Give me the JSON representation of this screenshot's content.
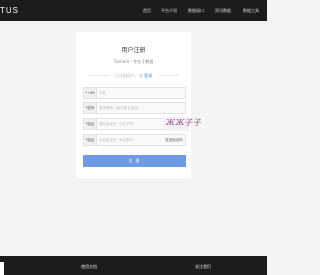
{
  "nav": {
    "logo": "TUSHARE",
    "items": [
      "首页",
      "平台介绍",
      "数据接口",
      "资讯数据",
      "数据工具"
    ]
  },
  "register": {
    "title": "用户注册",
    "subtitle": "Tushare - 专业于数据",
    "login_prompt": "已注册用户，请",
    "login_link": "登录",
    "phone_prefix": "+86",
    "phone_placeholder": "手机",
    "password_label": "密码",
    "password_placeholder": "登录密码（英文数字组合）",
    "captcha_label": "验证",
    "captcha_placeholder": "图形验证码（4位字符）",
    "captcha_text": "ЖЖ子子",
    "sms_label": "验证",
    "sms_placeholder": "手机验证码（6位数字）",
    "sms_button": "发送验证码",
    "submit_label": "注 册"
  },
  "footer": {
    "docs": "使用文档",
    "about": "关注我们"
  },
  "colors": {
    "nav_bg": "#1c1c1c",
    "accent": "#6f9be6",
    "link": "#3e8fd4"
  }
}
